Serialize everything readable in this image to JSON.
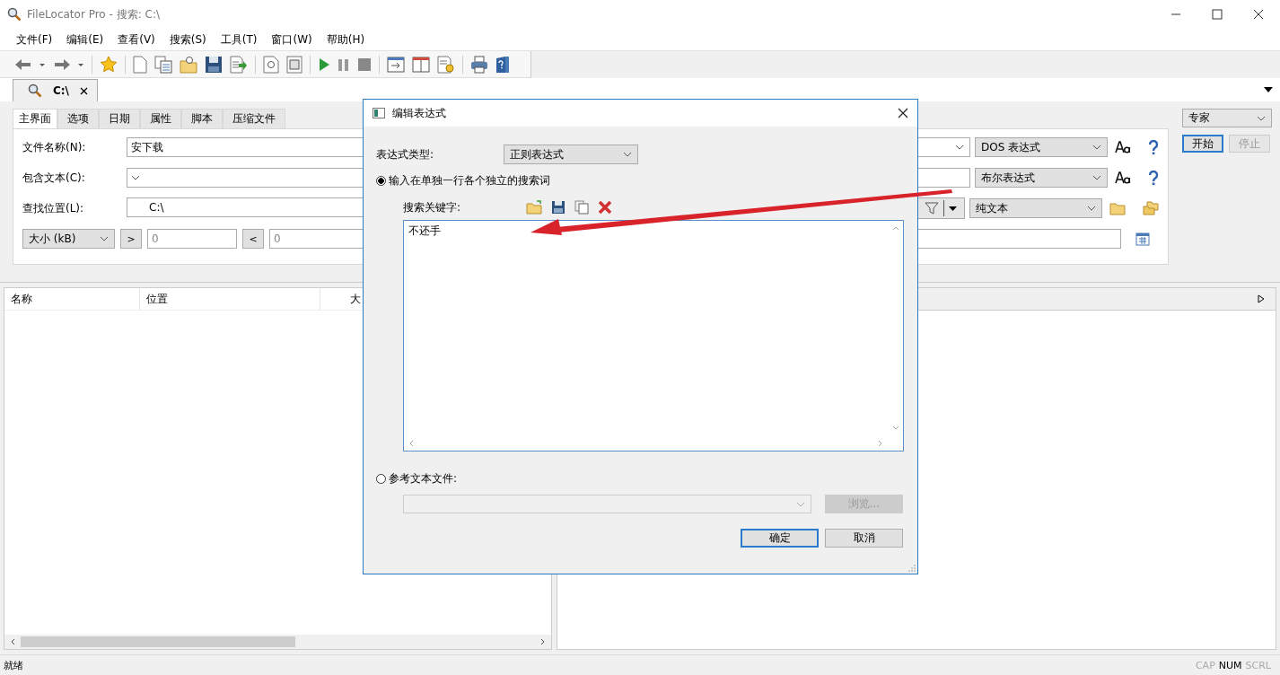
{
  "window": {
    "title": "FileLocator Pro - 搜索: C:\\"
  },
  "menu": [
    "文件(F)",
    "编辑(E)",
    "查看(V)",
    "搜索(S)",
    "工具(T)",
    "窗口(W)",
    "帮助(H)"
  ],
  "document_tabs": [
    {
      "label": "C:\\",
      "selected": true
    }
  ],
  "search_tabs": [
    {
      "label": "主界面",
      "selected": true
    },
    {
      "label": "选项",
      "selected": false
    },
    {
      "label": "日期",
      "selected": false
    },
    {
      "label": "属性",
      "selected": false
    },
    {
      "label": "脚本",
      "selected": false
    },
    {
      "label": "压缩文件",
      "selected": false
    }
  ],
  "fields": [
    {
      "label": "文件名称(N):",
      "value": "安下载",
      "mode": "DOS 表达式"
    },
    {
      "label": "包含文本(C):",
      "mode": "布尔表达式"
    }
  ],
  "location": {
    "label": "查找位置(L):",
    "value": "C:\\",
    "mode": "纯文本"
  },
  "size_filter": {
    "unit": "大小 (kB)",
    "greater_button": ">",
    "greater": "0",
    "less_button": "<",
    "less": "0"
  },
  "profile": "专家",
  "start_button": {
    "label": "开始",
    "disabled": false
  },
  "stop_button": {
    "label": "停止",
    "disabled": true
  },
  "results": {
    "columns": [
      "名称",
      "位置",
      "大"
    ]
  },
  "status_bar": {
    "text": "就绪",
    "indicators": [
      {
        "label": "CAP",
        "on": false
      },
      {
        "label": "NUM",
        "on": true
      },
      {
        "label": "SCRL",
        "on": false
      }
    ]
  },
  "dialog": {
    "title": "编辑表达式",
    "type_label": "表达式类型:",
    "type_value": "正则表达式",
    "options": [
      {
        "label": "输入在单独一行各个独立的搜索词",
        "selected": true
      },
      {
        "label": "参考文本文件:",
        "selected": false
      }
    ],
    "keywords_label": "搜索关键字:",
    "keywords": "不还手",
    "browse_button": {
      "label": "浏览...",
      "disabled": true
    },
    "buttons": [
      {
        "label": "确定",
        "default": true
      },
      {
        "label": "取消",
        "default": false
      }
    ]
  }
}
